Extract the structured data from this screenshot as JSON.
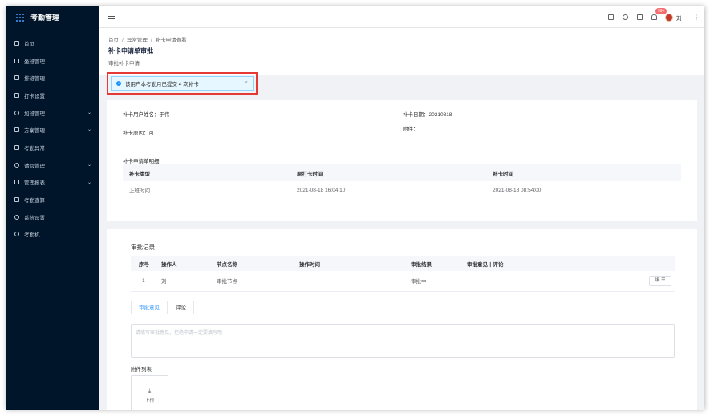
{
  "app": {
    "title": "考勤管理"
  },
  "sidebar": {
    "items": [
      {
        "label": "首页",
        "icon": "home-icon",
        "has_arrow": false
      },
      {
        "label": "坐班管理",
        "icon": "seat-icon",
        "has_arrow": false
      },
      {
        "label": "排班管理",
        "icon": "schedule-icon",
        "has_arrow": false
      },
      {
        "label": "打卡设置",
        "icon": "edit-icon",
        "has_arrow": false
      },
      {
        "label": "加班管理",
        "icon": "clock-icon",
        "has_arrow": true
      },
      {
        "label": "方案管理",
        "icon": "document-icon",
        "has_arrow": true
      },
      {
        "label": "考勤异常",
        "icon": "lock-icon",
        "has_arrow": false
      },
      {
        "label": "请假管理",
        "icon": "clock-icon",
        "has_arrow": true
      },
      {
        "label": "管理报表",
        "icon": "report-icon",
        "has_arrow": true
      },
      {
        "label": "考勤查算",
        "icon": "calculator-icon",
        "has_arrow": false
      },
      {
        "label": "系统设置",
        "icon": "gear-icon",
        "has_arrow": false
      },
      {
        "label": "考勤机",
        "icon": "device-icon",
        "has_arrow": false
      }
    ]
  },
  "header": {
    "badge": "99+",
    "username": "刘一"
  },
  "breadcrumb": {
    "items": [
      "首页",
      "异常管理",
      "补卡申请查看"
    ]
  },
  "page": {
    "title": "补卡申请单审批",
    "subtitle": "审批补卡申请"
  },
  "alert": {
    "text": "该用户本考勤月已提交 4 次补卡",
    "close": "×"
  },
  "info": {
    "name_label": "补卡用户姓名：",
    "name_value": "于伟",
    "date_label": "补卡日期：",
    "date_value": "20210818",
    "reason_label": "补卡原因：",
    "reason_value": "可",
    "attach_label": "附件："
  },
  "detail": {
    "title": "补卡申请单明细",
    "columns": [
      "补卡类型",
      "原打卡时间",
      "补卡时间"
    ],
    "rows": [
      [
        "上班时间",
        "2021-08-18 16:04:10",
        "2021-08-18 08:54:00"
      ]
    ]
  },
  "records": {
    "title": "审批记录",
    "columns": [
      "序号",
      "操作人",
      "节点名称",
      "操作时间",
      "审批结果",
      "审批意见丨评论"
    ],
    "rows": [
      {
        "no": "1",
        "operator": "刘一",
        "node": "审批节点",
        "time": "",
        "result": "审批中",
        "opinion": ""
      }
    ],
    "edit_label": "编 ☰"
  },
  "tabs": [
    {
      "label": "审批意见",
      "active": true
    },
    {
      "label": "评论",
      "active": false
    }
  ],
  "opinion": {
    "placeholder": "请填写审批意见，拒绝申请一定要填写哦"
  },
  "attachments": {
    "label": "附件列表",
    "upload_label": "上传"
  },
  "colors": {
    "sidebar_bg": "#001529",
    "accent": "#409eff",
    "warning": "#e6a23c",
    "highlight_border": "#e53935",
    "badge": "#f56c6c"
  }
}
